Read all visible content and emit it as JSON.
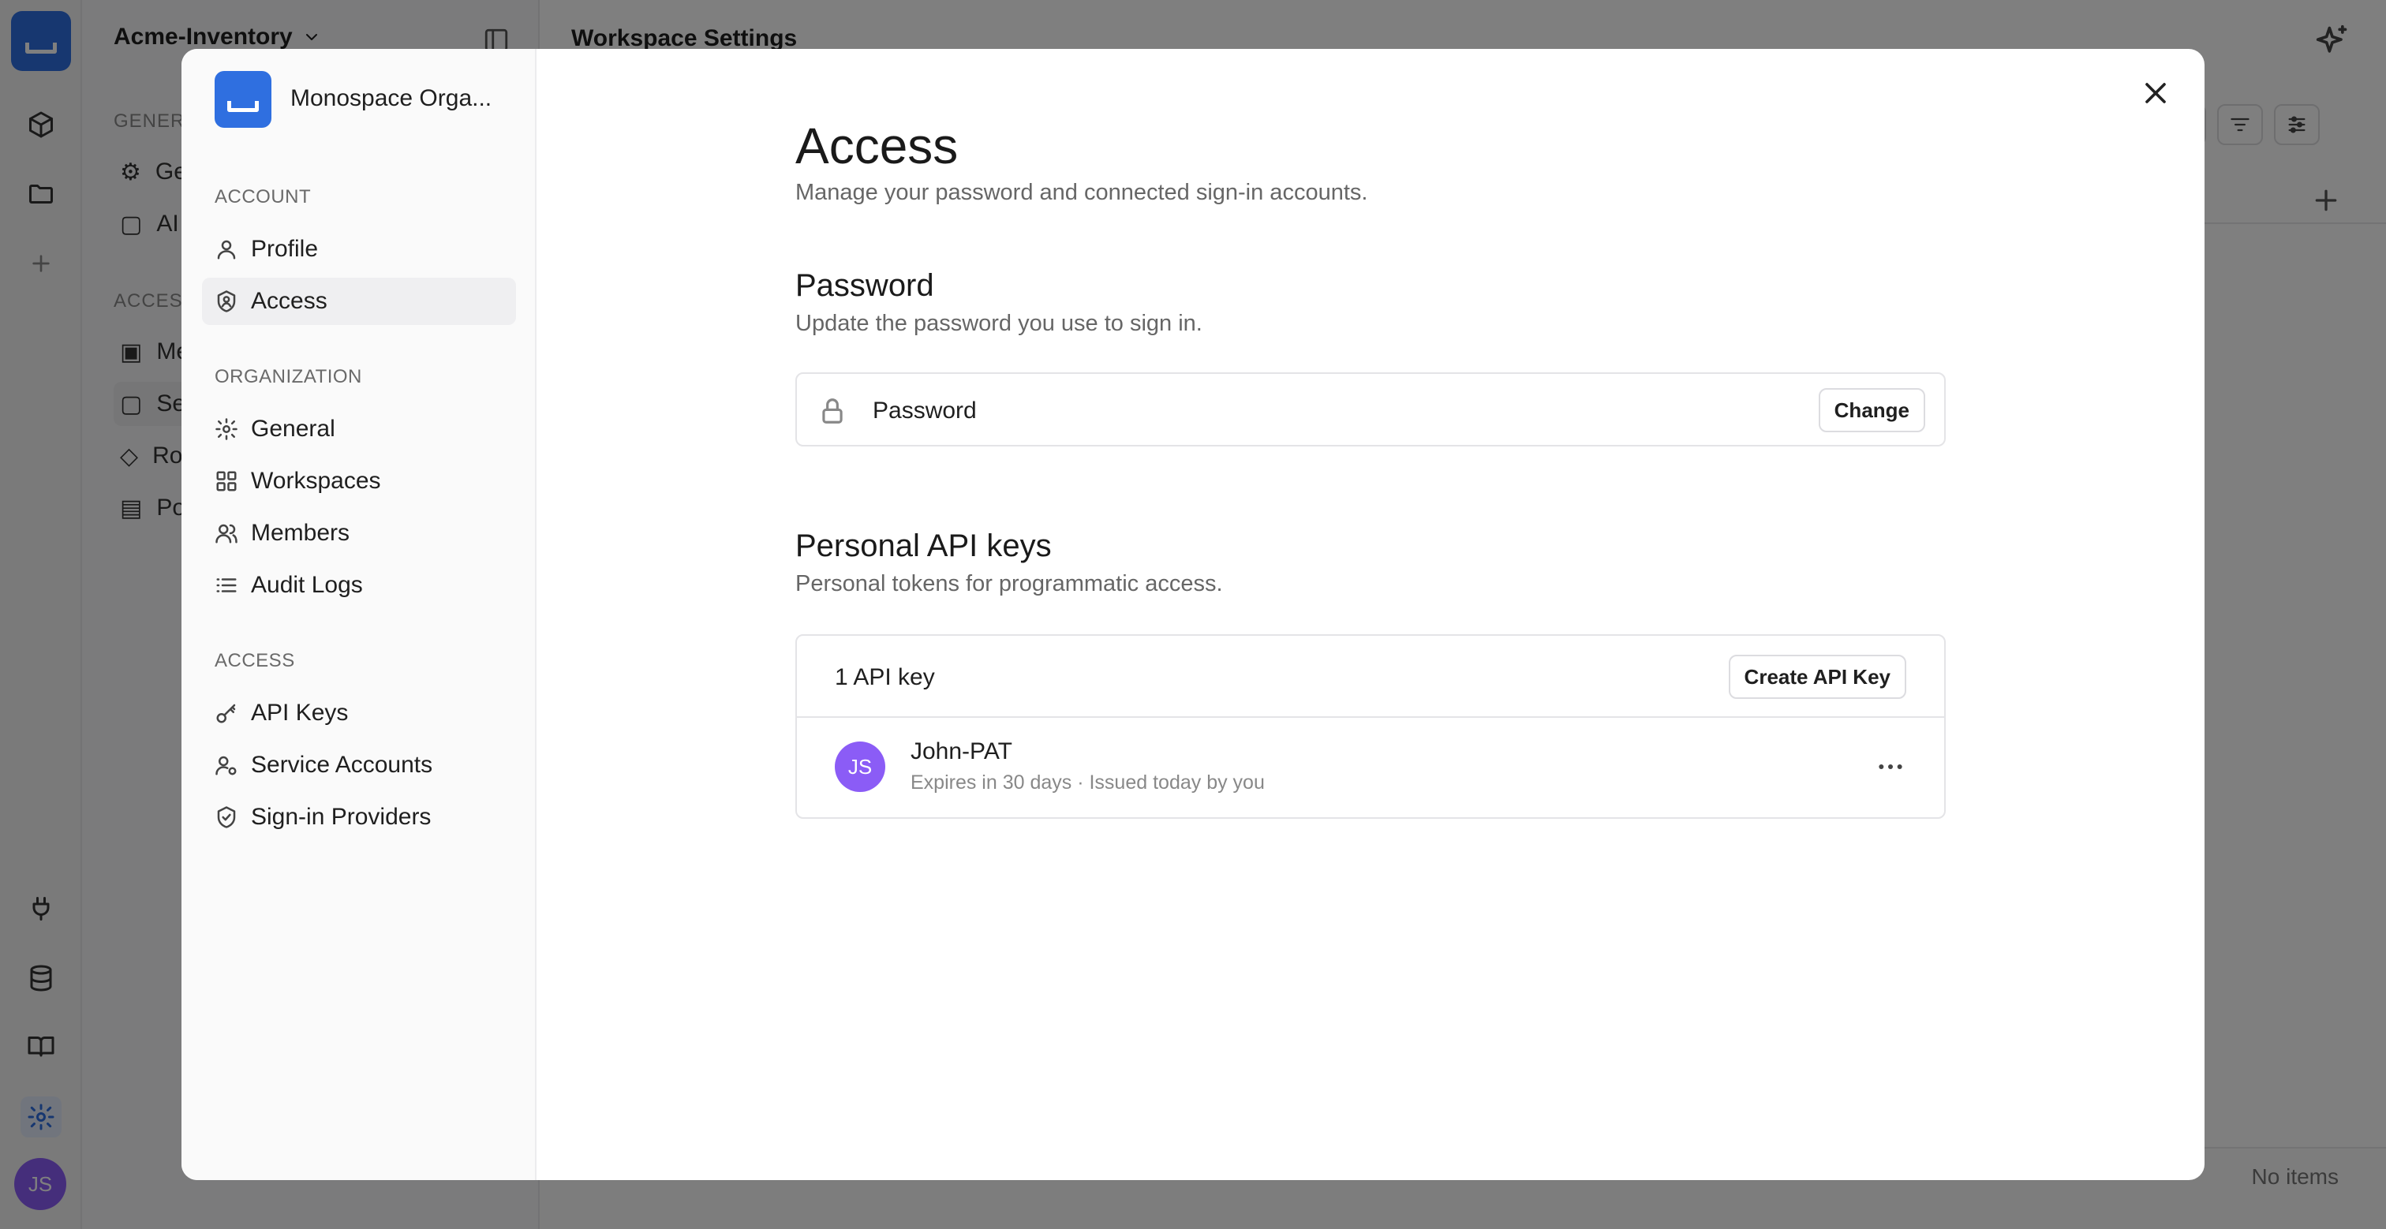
{
  "background": {
    "workspace_name": "Acme-Inventory",
    "page_title": "Workspace Settings",
    "side_general_section": "GENERA",
    "side_access_section": "ACCESS",
    "side_items": [
      "Ge",
      "AI",
      "Me",
      "Se",
      "Rol",
      "Pol"
    ],
    "no_items": "No items"
  },
  "user_initials": "JS",
  "modal": {
    "org_name": "Monospace Orga...",
    "sections": {
      "account": "ACCOUNT",
      "organization": "ORGANIZATION",
      "access": "ACCESS"
    },
    "nav": {
      "profile": "Profile",
      "access": "Access",
      "general": "General",
      "workspaces": "Workspaces",
      "members": "Members",
      "audit_logs": "Audit Logs",
      "api_keys": "API Keys",
      "service_accounts": "Service Accounts",
      "signin_providers": "Sign-in Providers"
    },
    "selected_nav": "Access",
    "content": {
      "title": "Access",
      "subtitle": "Manage your password and connected sign-in accounts.",
      "password": {
        "heading": "Password",
        "description": "Update the password you use to sign in.",
        "row_label": "Password",
        "change_button": "Change"
      },
      "api_keys": {
        "heading": "Personal API keys",
        "description": "Personal tokens for programmatic access.",
        "count_label": "1 API key",
        "create_button": "Create API Key",
        "keys": [
          {
            "initials": "JS",
            "name": "John-PAT",
            "meta": "Expires in 30 days · Issued today by you"
          }
        ]
      }
    }
  },
  "colors": {
    "accent": "#2f6fe0",
    "avatar": "#8b5cf6",
    "overlay": "rgba(0,0,0,0.5)"
  }
}
